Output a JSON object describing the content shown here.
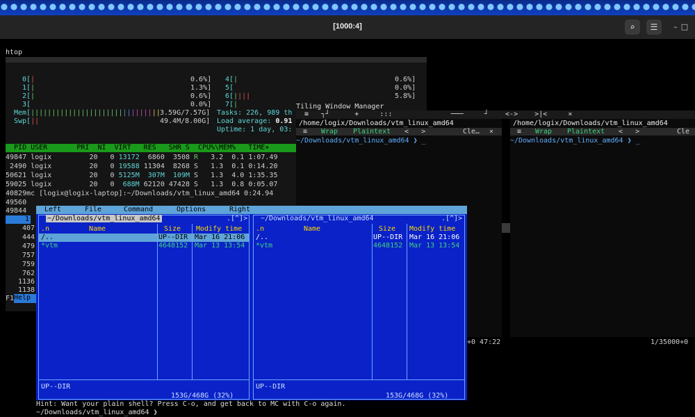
{
  "window": {
    "title": "[1000:4]",
    "buttons": {
      "search": "⌕",
      "menu": "☰",
      "minimize": "–",
      "maximize": "□",
      "close": "×"
    }
  },
  "htop": {
    "label": "htop",
    "cpu_left": [
      {
        "num": "0[",
        "val": "0.6%]"
      },
      {
        "num": "1[",
        "val": "1.3%]"
      },
      {
        "num": "2[",
        "val": "0.6%]"
      },
      {
        "num": "3[",
        "val": "0.0%]"
      }
    ],
    "cpu_right": [
      {
        "num": "4[",
        "val": "0.6%]"
      },
      {
        "num": "5[",
        "val": "0.0%]"
      },
      {
        "num": "6[",
        "val": "5.8%]"
      },
      {
        "num": "7[",
        "val": "0.6%]"
      }
    ],
    "mem_label": "Mem[",
    "mem_val": "3.59G/7.57G]",
    "swp_label": "Swp[",
    "swp_val": "49.4M/8.00G]",
    "tasks": "Tasks: 226, 989 th",
    "load_label": "Load average:",
    "load_val": "0.91",
    "uptime": "Uptime: 1 day, 03:",
    "header": "  PID USER       PRI  NI  VIRT   RES   SHR S  CPU%\\MEM%   TIME+",
    "processes": [
      {
        "pid": "49847",
        "user": "logix",
        "pri": "20",
        "ni": "0",
        "virt": "13172",
        "res": "6860",
        "shr": "3508",
        "s": "R",
        "cpu": "3.2",
        "mem": "0.1",
        "time": "1:07.49"
      },
      {
        "pid": " 2490",
        "user": "logix",
        "pri": "20",
        "ni": "0",
        "virt": "19588",
        "res": "11304",
        "shr": "8268",
        "s": "S",
        "cpu": "1.3",
        "mem": "0.1",
        "time": "0:14.20"
      },
      {
        "pid": "50621",
        "user": "logix",
        "pri": "20",
        "ni": "0",
        "virt": "5125M",
        "res": "307M",
        "shr": "109M",
        "s": "S",
        "cpu": "1.3",
        "mem": "4.0",
        "time": "1:35.35"
      },
      {
        "pid": "59025",
        "user": "logix",
        "pri": "20",
        "ni": "0",
        "virt": "688M",
        "res": "62120",
        "shr": "47428",
        "s": "S",
        "cpu": "1.3",
        "mem": "0.8",
        "time": "0:05.07"
      }
    ],
    "cmd_line": "40829mc [logix@logix-laptop]:~/Downloads/vtm_linux_amd64 0:24.94",
    "more_pids": [
      "49560",
      "49844",
      "1",
      "407",
      "444",
      "479",
      "757",
      "759",
      "762",
      "1136",
      "1138"
    ],
    "f1": "F1",
    "help": "Help"
  },
  "twm": {
    "title": "Tiling Window Manager",
    "bar": "  ≡   ┐┘      +     :::              ───     ┘    <->    >|<     ×",
    "left": {
      "path": "/home/logix/Downloads/vtm_linux_amd64",
      "menu_icon": "≡",
      "wrap": "Wrap",
      "plaintext": "Plaintext",
      "nav": "<   >",
      "clear": "Cle…",
      "close": "×",
      "prompt": "~/Downloads/vtm_linux_amd64 ❯ _",
      "status": "+0 47:22"
    },
    "right": {
      "path": "/home/logix/Downloads/vtm_linux_amd64",
      "menu_icon": "≡",
      "wrap": "Wrap",
      "plaintext": "Plaintext",
      "nav": "<   >",
      "clear": "Cle",
      "prompt": "~/Downloads/vtm_linux_amd64 ❯ _",
      "status": "1/35000+0"
    }
  },
  "mc": {
    "title": "mc [logix@logix-laptop]:~/Downloads/vtm_linux_amd64",
    "menu": [
      "Left",
      "File",
      "Command",
      "Options",
      "Right"
    ],
    "left_path": "~/Downloads/vtm_linux_amd64",
    "right_path": "~/Downloads/vtm_linux_amd64",
    "corner": ".[^]>",
    "cols": {
      "n": ".n",
      "name": "Name",
      "size": "Size",
      "mtime": "Modify time"
    },
    "rows": [
      {
        "name": "/..",
        "size": "UP--DIR",
        "mtime": "Mar 16 21:06"
      },
      {
        "name": "*vtm",
        "size": "4648152",
        "mtime": "Mar 13 13:54"
      }
    ],
    "footer_sel": "UP--DIR",
    "footer_disk": "153G/468G (32%)",
    "hint": "Hint: Want your plain shell? Press C-o, and get back to MC with C-o again.",
    "prompt": "~/Downloads/vtm_linux_amd64 ❯"
  },
  "colors": {
    "mc_blue": "#0a22c8",
    "htop_header_green": "#1a9a1a",
    "selection_blue": "#2a7ad8",
    "prompt_teal": "#3fd27f"
  }
}
